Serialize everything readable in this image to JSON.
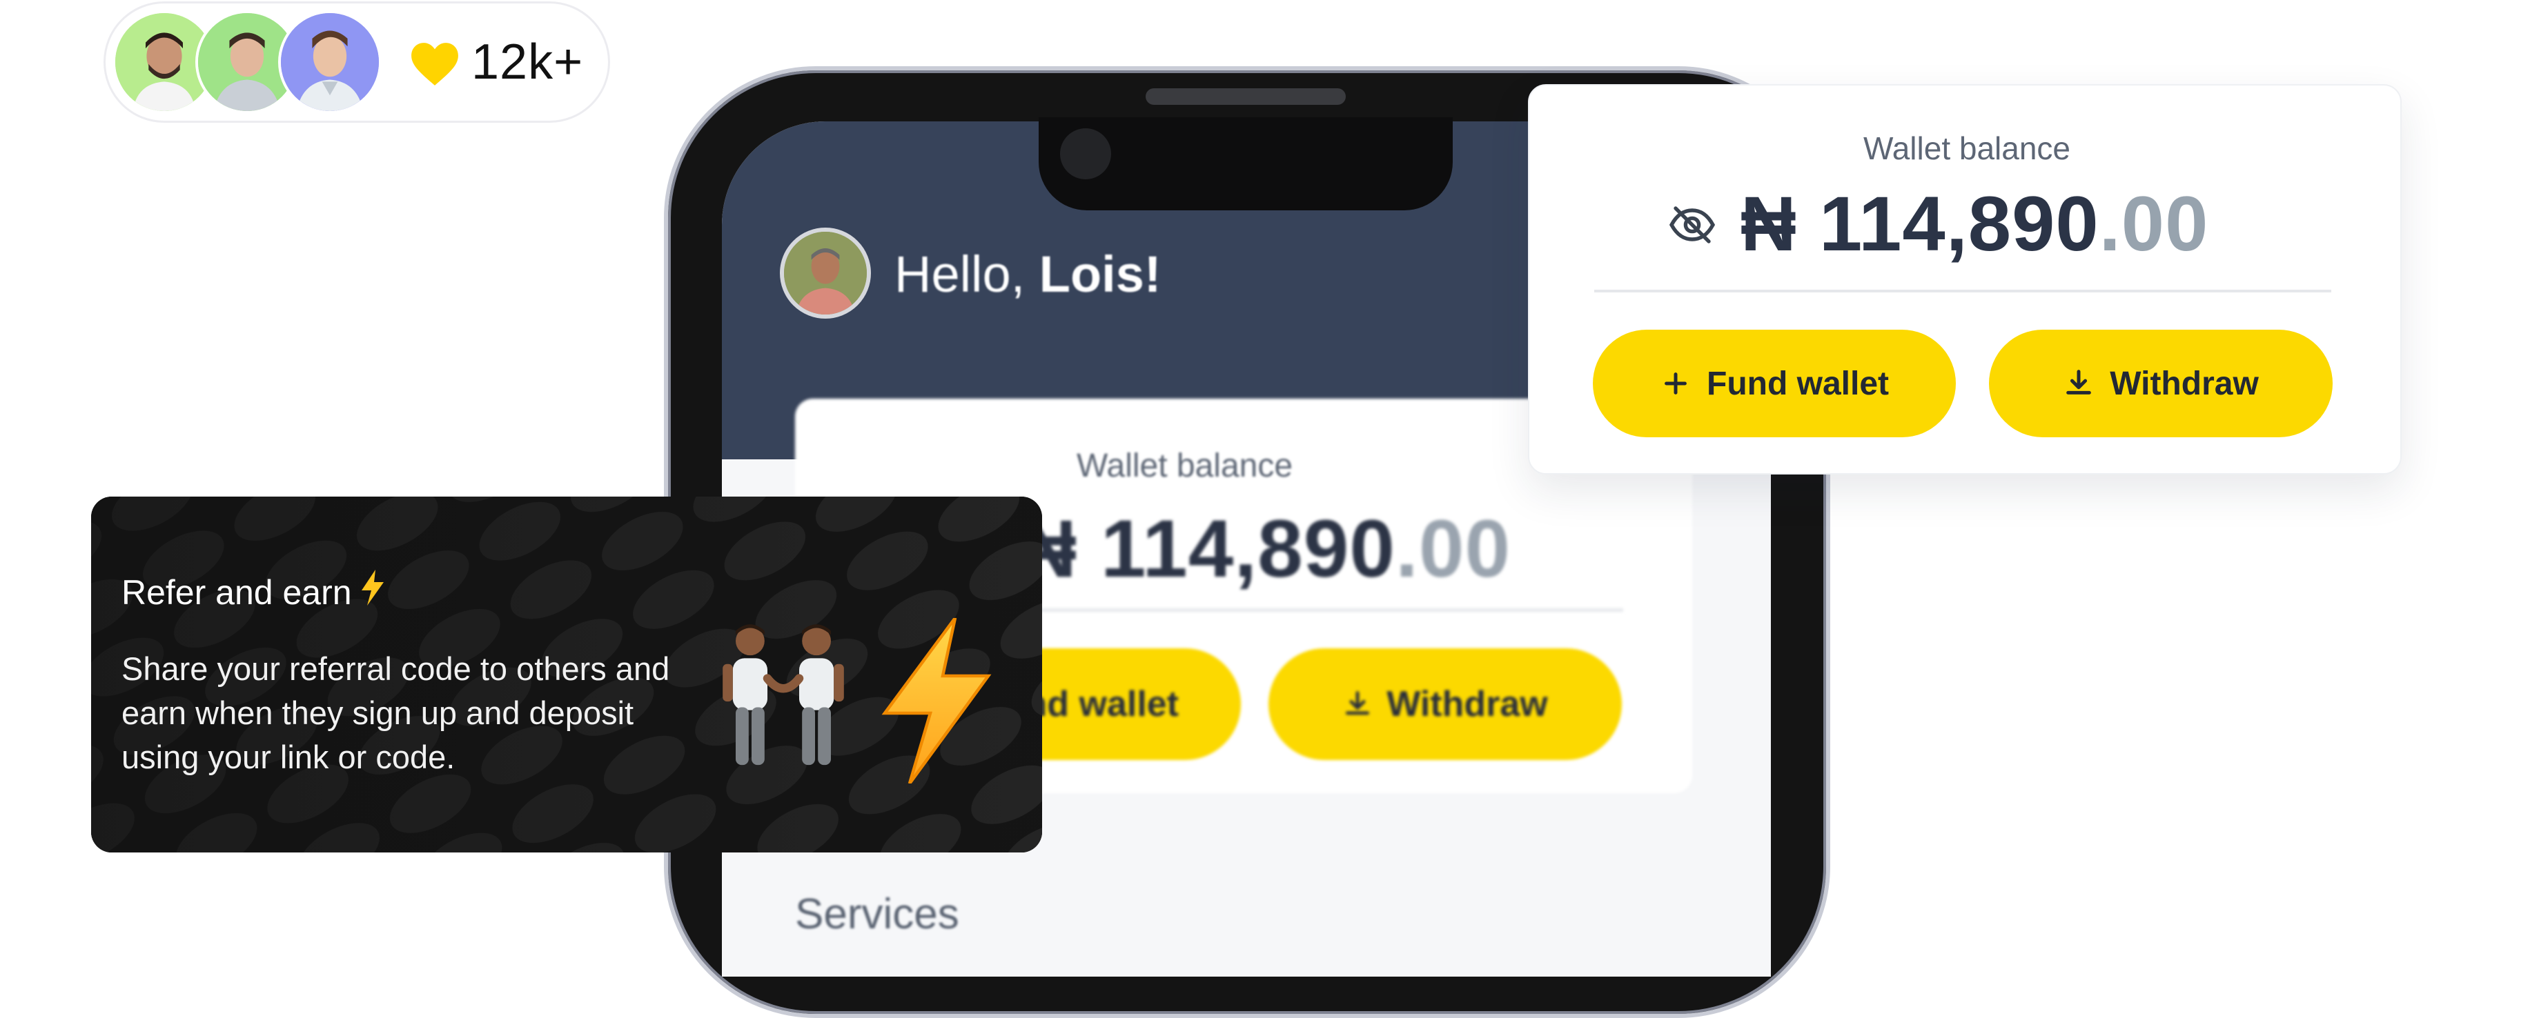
{
  "social_proof": {
    "count": "12k+",
    "avatars": [
      "user-avatar",
      "user-avatar",
      "user-avatar"
    ],
    "icon": "heart-icon"
  },
  "phone": {
    "greeting_prefix": "Hello, ",
    "greeting_name": "Lois!",
    "wallet_label": "Wallet balance",
    "balance_main": "₦ 114,890",
    "balance_decimal": ".00",
    "fund_label": "Fund wallet",
    "withdraw_label": "Withdraw",
    "services_label": "Services"
  },
  "wallet_card": {
    "label": "Wallet balance",
    "balance_main": "₦ 114,890",
    "balance_decimal": ".00",
    "fund_label": "Fund wallet",
    "withdraw_label": "Withdraw",
    "visibility_icon": "eye-off-icon"
  },
  "refer_card": {
    "title": "Refer and earn",
    "description": "Share your referral code to others and earn when they sign up and deposit using your link or code."
  },
  "colors": {
    "accent": "#fcd900",
    "header_bg": "#37435a",
    "text_dark": "#2b3447",
    "text_muted": "#97a3ae",
    "card_dark": "#141414"
  }
}
